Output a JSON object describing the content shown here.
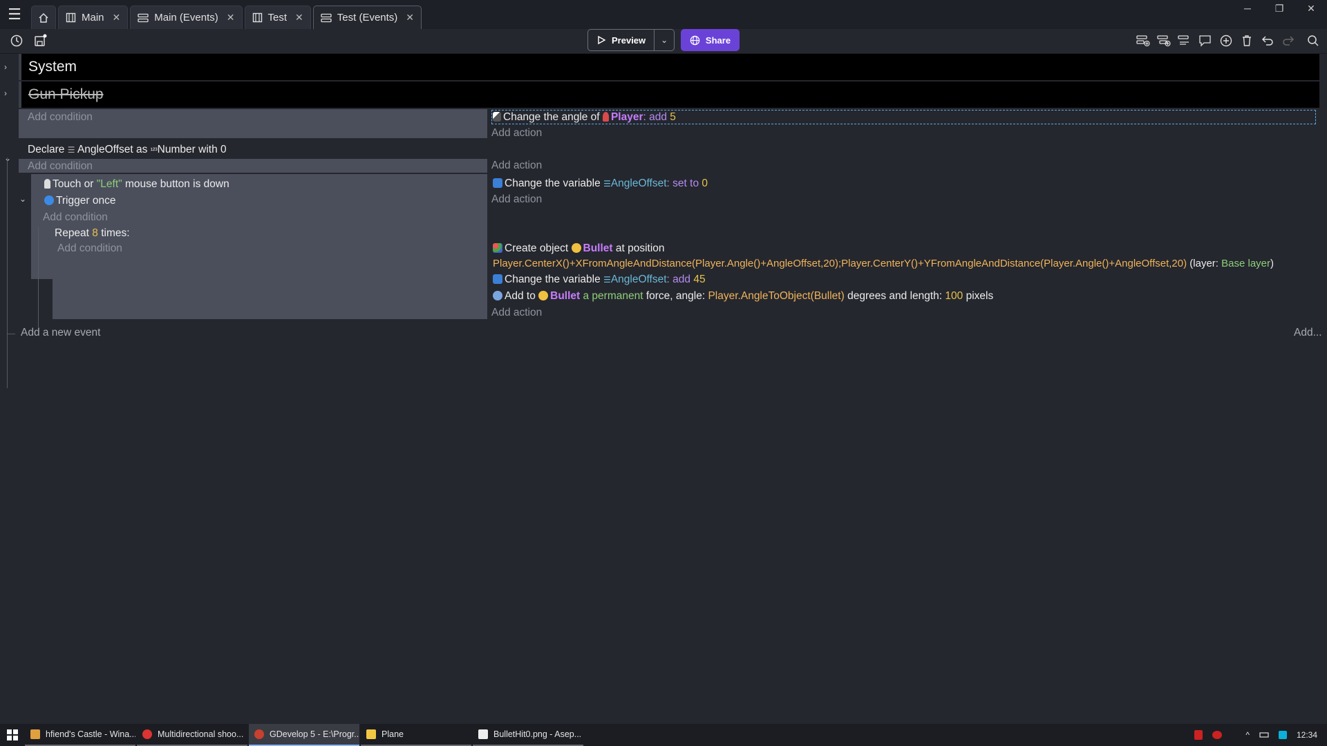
{
  "tabs": [
    {
      "label": "Main",
      "icon": "scene-icon"
    },
    {
      "label": "Main (Events)",
      "icon": "events-icon"
    },
    {
      "label": "Test",
      "icon": "scene-icon"
    },
    {
      "label": "Test (Events)",
      "icon": "events-icon",
      "active": true
    }
  ],
  "toolbar": {
    "preview_label": "Preview",
    "share_label": "Share"
  },
  "events": {
    "group_system": "System",
    "group_gun_pickup": "Gun Pickup",
    "add_condition": "Add condition",
    "add_action": "Add action",
    "add_new_event": "Add a new event",
    "add_more": "Add...",
    "ev1": {
      "action_prefix": "Change the angle of",
      "action_object": "Player",
      "action_op": ": add",
      "action_value": "5"
    },
    "ev2": {
      "declare": "Declare",
      "var_name": "AngleOffset",
      "as": "as",
      "type": "Number",
      "with": "with",
      "value": "0"
    },
    "ev3": {
      "cond1_prefix": "Touch or",
      "cond1_str": "\"Left\"",
      "cond1_suffix": "mouse button is down",
      "cond2": "Trigger once",
      "action_prefix": "Change the variable",
      "action_var": "AngleOffset",
      "action_op": ": set to",
      "action_value": "0"
    },
    "ev4": {
      "repeat_prefix": "Repeat",
      "repeat_count": "8",
      "repeat_suffix": "times:",
      "a1_prefix": "Create object",
      "a1_object": "Bullet",
      "a1_suffix": "at position",
      "a1_expr": "Player.CenterX()+XFromAngleAndDistance(Player.Angle()+AngleOffset,20);Player.CenterY()+YFromAngleAndDistance(Player.Angle()+AngleOffset,20)",
      "a1_layer_prefix": "(layer:",
      "a1_layer": "Base layer",
      "a1_layer_suffix": ")",
      "a2_prefix": "Change the variable",
      "a2_var": "AngleOffset",
      "a2_op": ": add",
      "a2_value": "45",
      "a3_prefix": "Add to",
      "a3_object": "Bullet",
      "a3_force": "a permanent",
      "a3_mid": "force, angle:",
      "a3_expr": "Player.AngleToObject(Bullet)",
      "a3_mid2": "degrees and length:",
      "a3_len": "100",
      "a3_suffix": "pixels"
    }
  },
  "taskbar": {
    "items": [
      {
        "label": "hfiend's Castle - Wina..."
      },
      {
        "label": "Multidirectional shoo..."
      },
      {
        "label": "GDevelop 5 - E:\\Progr...",
        "active": true
      },
      {
        "label": "Plane"
      },
      {
        "label": "BulletHit0.png - Asep..."
      }
    ],
    "clock": "12:34"
  },
  "colors": {
    "accent_share": "#6b42d8",
    "condition_bg": "#4b4f5c",
    "group_bg": "#000000",
    "background": "#25272e"
  }
}
